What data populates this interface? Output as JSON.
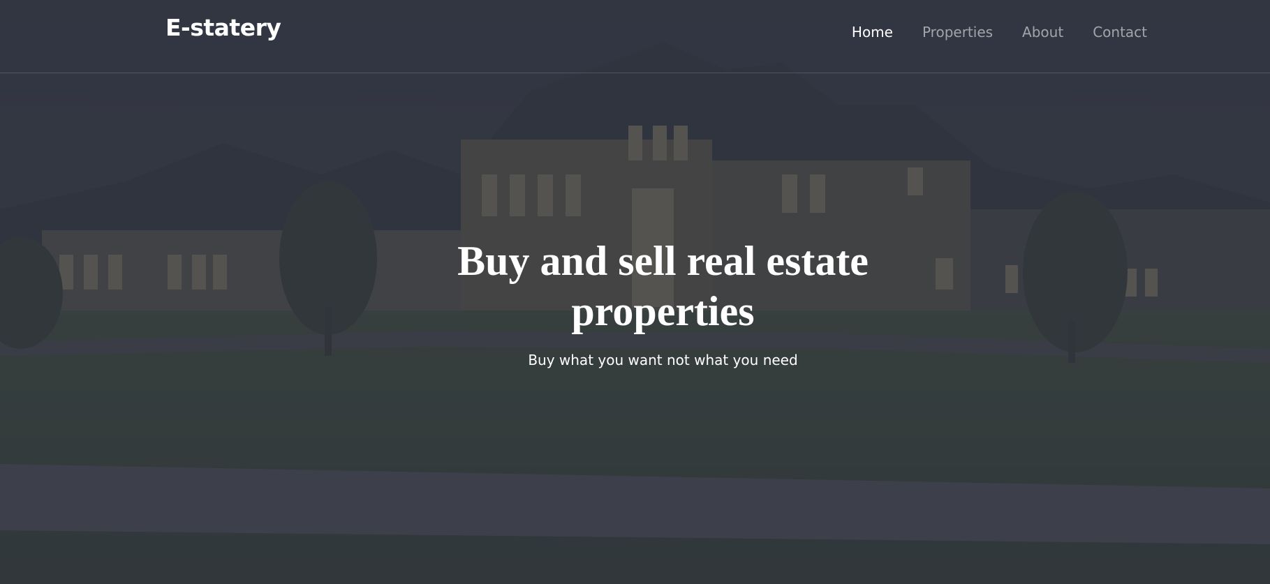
{
  "brand": {
    "name": "E-statery"
  },
  "nav": {
    "items": [
      {
        "label": "Home",
        "active": true
      },
      {
        "label": "Properties",
        "active": false
      },
      {
        "label": "About",
        "active": false
      },
      {
        "label": "Contact",
        "active": false
      }
    ]
  },
  "hero": {
    "title": "Buy and sell real estate properties",
    "subtitle": "Buy what you want not what you need"
  },
  "colors": {
    "overlay": "#343944",
    "text": "#ffffff",
    "nav_inactive": "#a4a7ae"
  }
}
